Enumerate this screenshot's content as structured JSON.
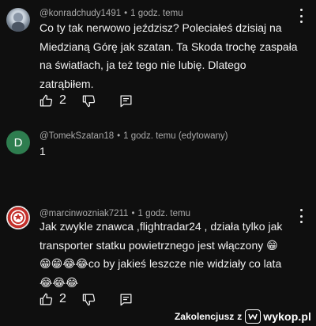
{
  "comments": [
    {
      "avatar_icon": "user-photo",
      "author": "@konradchudy1491",
      "time": "1 godz. temu",
      "lines": [
        "Co ty tak nerwowo jeździsz? Poleciałeś dzisiaj na",
        "Miedzianą Górę jak szatan. Ta Skoda trochę zaspała",
        "na światłach, ja też tego nie lubię. Dlatego",
        "zatrąbiłem."
      ],
      "likes": "2"
    },
    {
      "avatar_letter": "D",
      "author": "@TomekSzatan18",
      "time": "1 godz. temu (edytowany)",
      "lines": [
        "1"
      ]
    },
    {
      "avatar_icon": "emblem",
      "author": "@marcinwozniak7211",
      "time": "1 godz. temu",
      "lines": [
        "Jak zwykle znawca ,flightradar24 , działa tylko jak",
        "transporter statku powietrznego jest włączony 😁",
        "😁😁😂😂co by jakieś leszcze nie widziały co lata",
        "😂😂😂"
      ],
      "likes": "2"
    }
  ],
  "footer": {
    "user": "Zakolencjusz",
    "connector": "z",
    "site": "wykop.pl"
  },
  "colors": {
    "background": "#0f0f0f",
    "text": "#f1f1f1",
    "meta": "#aaaaaa",
    "avatar_letter_bg": "#2e7d4f"
  }
}
